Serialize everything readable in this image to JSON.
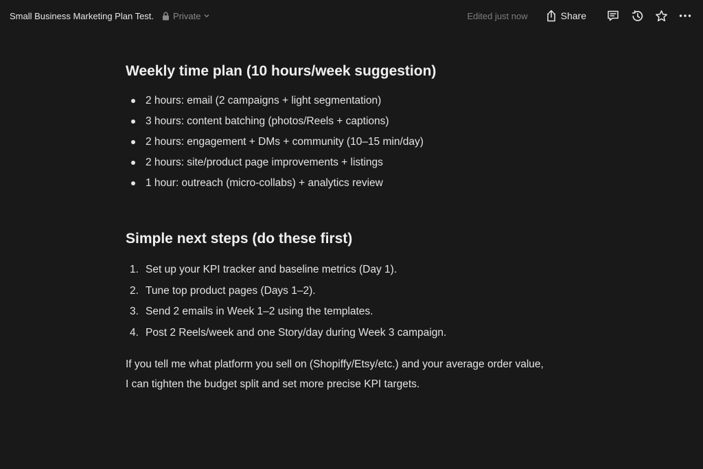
{
  "topbar": {
    "title": "Small Business Marketing Plan Test.",
    "privacy_label": "Private",
    "edited_label": "Edited just now",
    "share_label": "Share",
    "icons": [
      "lock-icon",
      "chevron-down-icon",
      "share-icon",
      "comment-icon",
      "history-icon",
      "star-icon",
      "more-icon"
    ]
  },
  "section1": {
    "heading": "Weekly time plan (10 hours/week suggestion)",
    "items": [
      "2 hours: email (2 campaigns + light segmentation)",
      "3 hours: content batching (photos/Reels + captions)",
      "2 hours: engagement + DMs + community (10–15 min/day)",
      "2 hours: site/product page improvements + listings",
      "1 hour: outreach (micro-collabs) + analytics review"
    ]
  },
  "section2": {
    "heading": "Simple next steps (do these first)",
    "items": [
      {
        "num": "1.",
        "text": "Set up your KPI tracker and baseline metrics (Day 1)."
      },
      {
        "num": "2.",
        "text": "Tune top product pages (Days 1–2)."
      },
      {
        "num": "3.",
        "text": "Send 2 emails in Week 1–2 using the templates."
      },
      {
        "num": "4.",
        "text": "Post 2 Reels/week and one Story/day during Week 3 campaign."
      }
    ]
  },
  "closing": {
    "line1": "If you tell me what platform you sell on (Shopiffy/Etsy/etc.) and your average order value,",
    "line2": "I can tighten the budget split and set more precise KPI targets."
  }
}
